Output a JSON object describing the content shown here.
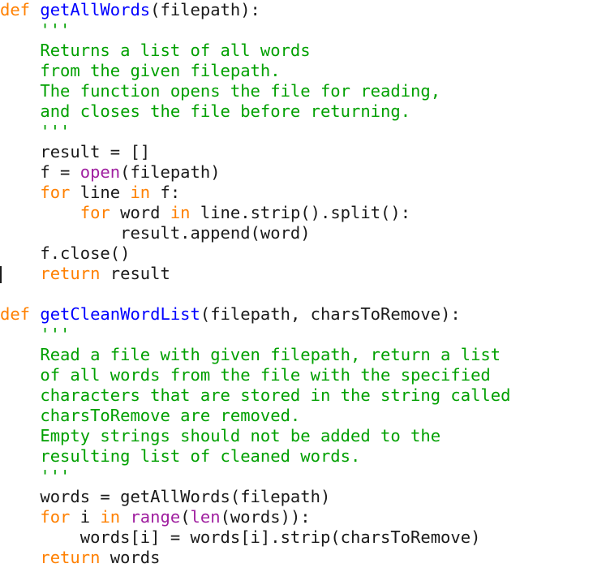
{
  "editor": {
    "language": "python",
    "background_color": "#ffffff",
    "caret": {
      "line_index": 13,
      "column": 0,
      "color": "#1a1a1a"
    },
    "theme_colors": {
      "keyword": "#ff8000",
      "function_name": "#0000ff",
      "builtin": "#a020a0",
      "string": "#00a000",
      "plain": "#1a1a1a",
      "background": "#ffffff"
    }
  },
  "code": {
    "lines": [
      {
        "tokens": [
          {
            "t": "def",
            "c": "kw"
          },
          {
            "t": " ",
            "c": "plain"
          },
          {
            "t": "getAllWords",
            "c": "fn"
          },
          {
            "t": "(filepath):",
            "c": "plain"
          }
        ]
      },
      {
        "tokens": [
          {
            "t": "    ",
            "c": "plain"
          },
          {
            "t": "'''",
            "c": "str"
          }
        ]
      },
      {
        "tokens": [
          {
            "t": "    ",
            "c": "plain"
          },
          {
            "t": "Returns a list of all words",
            "c": "str"
          }
        ]
      },
      {
        "tokens": [
          {
            "t": "    ",
            "c": "plain"
          },
          {
            "t": "from the given filepath.",
            "c": "str"
          }
        ]
      },
      {
        "tokens": [
          {
            "t": "    ",
            "c": "plain"
          },
          {
            "t": "The function opens the file for reading,",
            "c": "str"
          }
        ]
      },
      {
        "tokens": [
          {
            "t": "    ",
            "c": "plain"
          },
          {
            "t": "and closes the file before returning.",
            "c": "str"
          }
        ]
      },
      {
        "tokens": [
          {
            "t": "    ",
            "c": "plain"
          },
          {
            "t": "'''",
            "c": "str"
          }
        ]
      },
      {
        "tokens": [
          {
            "t": "    result = []",
            "c": "plain"
          }
        ]
      },
      {
        "tokens": [
          {
            "t": "    f = ",
            "c": "plain"
          },
          {
            "t": "open",
            "c": "builtin"
          },
          {
            "t": "(filepath)",
            "c": "plain"
          }
        ]
      },
      {
        "tokens": [
          {
            "t": "    ",
            "c": "plain"
          },
          {
            "t": "for",
            "c": "kw"
          },
          {
            "t": " line ",
            "c": "plain"
          },
          {
            "t": "in",
            "c": "kw"
          },
          {
            "t": " f:",
            "c": "plain"
          }
        ]
      },
      {
        "tokens": [
          {
            "t": "        ",
            "c": "plain"
          },
          {
            "t": "for",
            "c": "kw"
          },
          {
            "t": " word ",
            "c": "plain"
          },
          {
            "t": "in",
            "c": "kw"
          },
          {
            "t": " line.strip().split():",
            "c": "plain"
          }
        ]
      },
      {
        "tokens": [
          {
            "t": "            result.append(word)",
            "c": "plain"
          }
        ]
      },
      {
        "tokens": [
          {
            "t": "    f.close()",
            "c": "plain"
          }
        ]
      },
      {
        "tokens": [
          {
            "t": "    ",
            "c": "plain"
          },
          {
            "t": "return",
            "c": "kw"
          },
          {
            "t": " result",
            "c": "plain"
          }
        ]
      },
      {
        "tokens": [
          {
            "t": "",
            "c": "plain"
          }
        ]
      },
      {
        "tokens": [
          {
            "t": "def",
            "c": "kw"
          },
          {
            "t": " ",
            "c": "plain"
          },
          {
            "t": "getCleanWordList",
            "c": "fn"
          },
          {
            "t": "(filepath, charsToRemove):",
            "c": "plain"
          }
        ]
      },
      {
        "tokens": [
          {
            "t": "    ",
            "c": "plain"
          },
          {
            "t": "'''",
            "c": "str"
          }
        ]
      },
      {
        "tokens": [
          {
            "t": "    ",
            "c": "plain"
          },
          {
            "t": "Read a file with given filepath, return a list",
            "c": "str"
          }
        ]
      },
      {
        "tokens": [
          {
            "t": "    ",
            "c": "plain"
          },
          {
            "t": "of all words from the file with the specified",
            "c": "str"
          }
        ]
      },
      {
        "tokens": [
          {
            "t": "    ",
            "c": "plain"
          },
          {
            "t": "characters that are stored in the string called",
            "c": "str"
          }
        ]
      },
      {
        "tokens": [
          {
            "t": "    ",
            "c": "plain"
          },
          {
            "t": "charsToRemove are removed.",
            "c": "str"
          }
        ]
      },
      {
        "tokens": [
          {
            "t": "    ",
            "c": "plain"
          },
          {
            "t": "Empty strings should not be added to the",
            "c": "str"
          }
        ]
      },
      {
        "tokens": [
          {
            "t": "    ",
            "c": "plain"
          },
          {
            "t": "resulting list of cleaned words.",
            "c": "str"
          }
        ]
      },
      {
        "tokens": [
          {
            "t": "    ",
            "c": "plain"
          },
          {
            "t": "'''",
            "c": "str"
          }
        ]
      },
      {
        "tokens": [
          {
            "t": "    words = getAllWords(filepath)",
            "c": "plain"
          }
        ]
      },
      {
        "tokens": [
          {
            "t": "    ",
            "c": "plain"
          },
          {
            "t": "for",
            "c": "kw"
          },
          {
            "t": " i ",
            "c": "plain"
          },
          {
            "t": "in",
            "c": "kw"
          },
          {
            "t": " ",
            "c": "plain"
          },
          {
            "t": "range",
            "c": "builtin"
          },
          {
            "t": "(",
            "c": "plain"
          },
          {
            "t": "len",
            "c": "builtin"
          },
          {
            "t": "(words)):",
            "c": "plain"
          }
        ]
      },
      {
        "tokens": [
          {
            "t": "        words[i] = words[i].strip(charsToRemove)",
            "c": "plain"
          }
        ]
      },
      {
        "tokens": [
          {
            "t": "    ",
            "c": "plain"
          },
          {
            "t": "return",
            "c": "kw"
          },
          {
            "t": " words",
            "c": "plain"
          }
        ]
      }
    ]
  }
}
